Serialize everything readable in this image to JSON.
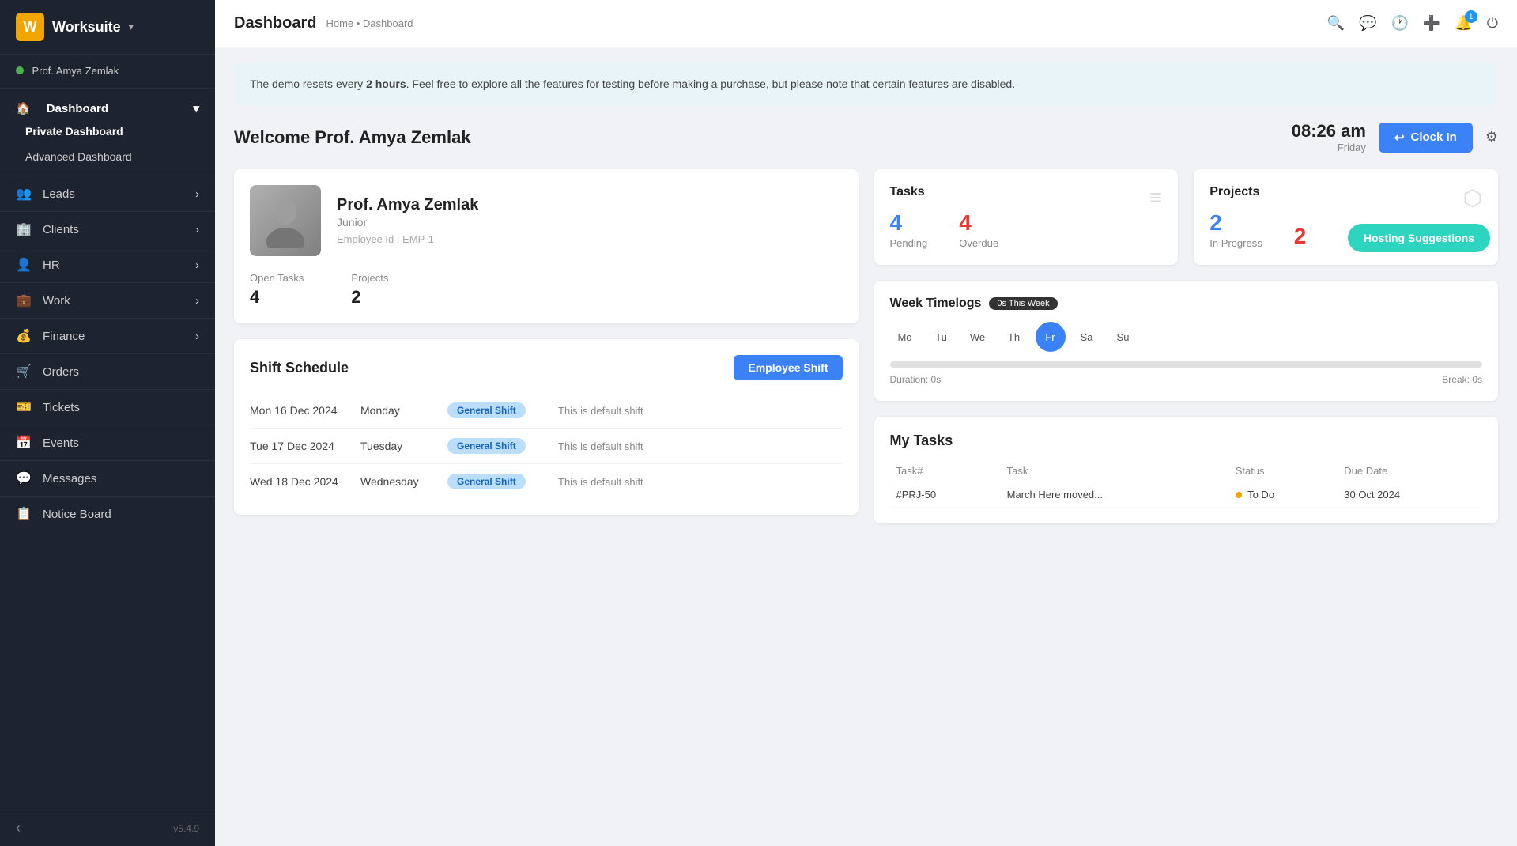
{
  "brand": {
    "name": "Worksuite",
    "logo_letter": "W",
    "chevron": "▾"
  },
  "user": {
    "name": "Prof. Amya Zemlak",
    "role": "Junior",
    "employee_id": "EMP-1",
    "online_status": "●"
  },
  "sidebar": {
    "dashboard_label": "Dashboard",
    "sub_items": [
      {
        "label": "Private Dashboard",
        "active": true
      },
      {
        "label": "Advanced Dashboard",
        "active": false
      }
    ],
    "nav_items": [
      {
        "label": "Leads",
        "icon": "👥",
        "has_arrow": true
      },
      {
        "label": "Clients",
        "icon": "🏢",
        "has_arrow": true
      },
      {
        "label": "HR",
        "icon": "👤",
        "has_arrow": true
      },
      {
        "label": "Work",
        "icon": "💼",
        "has_arrow": true
      },
      {
        "label": "Finance",
        "icon": "💰",
        "has_arrow": true
      },
      {
        "label": "Orders",
        "icon": "🛒",
        "has_arrow": false
      },
      {
        "label": "Tickets",
        "icon": "🎫",
        "has_arrow": false
      },
      {
        "label": "Events",
        "icon": "📅",
        "has_arrow": false
      },
      {
        "label": "Messages",
        "icon": "💬",
        "has_arrow": false
      },
      {
        "label": "Notice Board",
        "icon": "📋",
        "has_arrow": false
      }
    ],
    "version": "v5.4.9"
  },
  "topbar": {
    "title": "Dashboard",
    "breadcrumb": "Home • Dashboard",
    "notification_count": "1"
  },
  "banner": {
    "text_before": "The demo resets every ",
    "highlight": "2 hours",
    "text_after": ". Feel free to explore all the features for testing before making a purchase, but please note that certain features are disabled."
  },
  "welcome": {
    "greeting": "Welcome Prof. Amya Zemlak",
    "time": "08:26 am",
    "day": "Friday",
    "clock_in_label": "Clock In"
  },
  "profile_card": {
    "name": "Prof. Amya Zemlak",
    "role": "Junior",
    "employee_id_label": "Employee Id : EMP-1",
    "open_tasks_label": "Open Tasks",
    "open_tasks_value": "4",
    "projects_label": "Projects",
    "projects_value": "2"
  },
  "tasks_card": {
    "title": "Tasks",
    "pending_count": "4",
    "pending_label": "Pending",
    "overdue_count": "4",
    "overdue_label": "Overdue"
  },
  "projects_card": {
    "title": "Projects",
    "in_progress_count": "2",
    "in_progress_label": "In Progress",
    "overdue_count": "2",
    "hosting_btn_label": "Hosting Suggestions"
  },
  "week_timelogs": {
    "title": "Week Timelogs",
    "badge": "0s This Week",
    "days": [
      "Mo",
      "Tu",
      "We",
      "Th",
      "Fr",
      "Sa",
      "Su"
    ],
    "active_day": "Fr",
    "duration_label": "Duration: 0s",
    "break_label": "Break: 0s"
  },
  "shift_schedule": {
    "title": "Shift Schedule",
    "btn_label": "Employee Shift",
    "rows": [
      {
        "date": "Mon 16 Dec 2024",
        "day": "Monday",
        "badge": "General Shift",
        "desc": "This is default shift"
      },
      {
        "date": "Tue 17 Dec 2024",
        "day": "Tuesday",
        "badge": "General Shift",
        "desc": "This is default shift"
      },
      {
        "date": "Wed 18 Dec 2024",
        "day": "Wednesday",
        "badge": "General Shift",
        "desc": "This is default shift"
      }
    ]
  },
  "my_tasks": {
    "title": "My Tasks",
    "columns": [
      "Task#",
      "Task",
      "Status",
      "Due Date"
    ],
    "row_task_num": "#PRJ-50",
    "row_task_name": "March Here moved...",
    "row_status": "To Do",
    "row_due": "30 Oct 2024"
  }
}
